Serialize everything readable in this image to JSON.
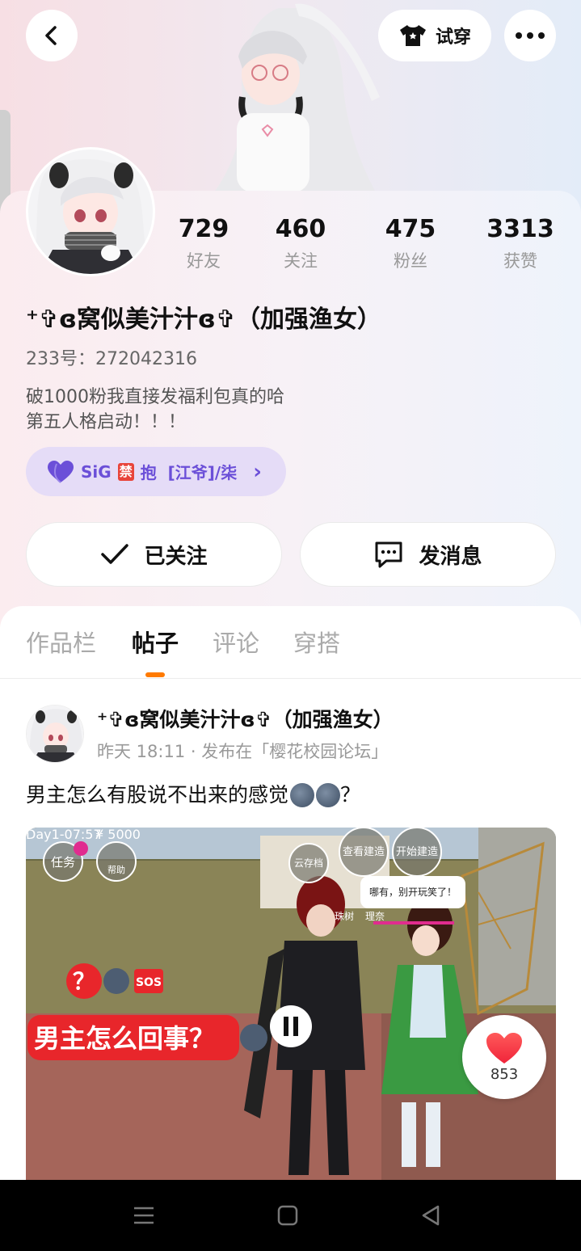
{
  "header": {
    "try_on_label": "试穿",
    "icons": [
      "back-arrow-icon",
      "shirt-icon",
      "more-dots-icon"
    ]
  },
  "profile": {
    "stats": [
      {
        "value": "729",
        "label": "好友"
      },
      {
        "value": "460",
        "label": "关注"
      },
      {
        "value": "475",
        "label": "粉丝"
      },
      {
        "value": "3313",
        "label": "获赞"
      }
    ],
    "name": "⁺✞ɞ窝似美汁汁ɞ✞（加强渔女）",
    "uid": "233号：272042316",
    "bio_line1": "破1000粉我直接发福利包真的哈",
    "bio_line2": "第五人格启动！！！",
    "badge": {
      "prefix": "SiG",
      "ban": "禁",
      "rest": "抱  [江爷]/柒",
      "chevron": "›",
      "color": "#6b4fd8"
    }
  },
  "actions": {
    "follow_label": "已关注",
    "message_label": "发消息"
  },
  "tabs": [
    {
      "label": "作品栏"
    },
    {
      "label": "帖子"
    },
    {
      "label": "评论"
    },
    {
      "label": "穿搭"
    }
  ],
  "post": {
    "author": "⁺✞ɞ窝似美汁汁ɞ✞（加强渔女）",
    "meta": "昨天 18:11 · 发布在「樱花校园论坛」",
    "title": "男主怎么有股说不出来的感觉",
    "title_suffix": "？",
    "image": {
      "hud_day": "Day1-07:57",
      "hud_money": "¥  5000",
      "task_label": "任务",
      "help_label": "帮助",
      "cloud_label": "云存档",
      "view_build": "查看建造",
      "start_build": "开始建造",
      "speech": "哪有，别开玩笑了！",
      "npc1": "珠树",
      "npc2": "理奈",
      "caption_q": "？",
      "sos": "SOS",
      "caption": "男主怎么回事？"
    },
    "likes": "853"
  },
  "accent_color": "#ff7a00"
}
